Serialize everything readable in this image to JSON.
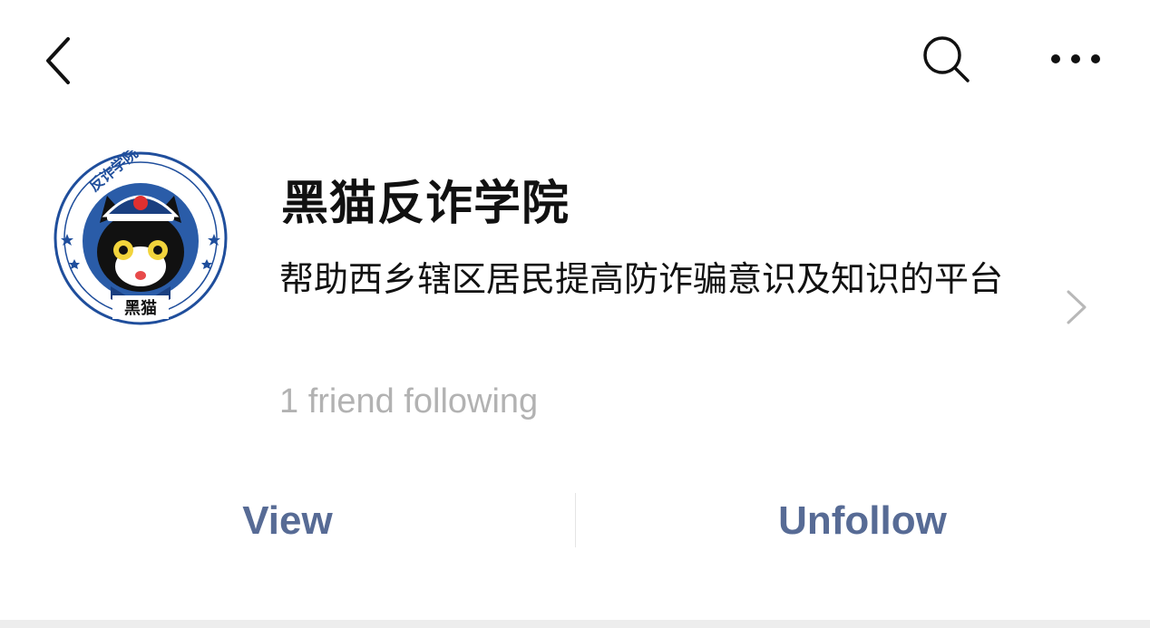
{
  "header": {
    "back_icon": "chevron-left-icon",
    "search_icon": "search-icon",
    "more_icon": "more-horizontal-icon"
  },
  "profile": {
    "name": "黑猫反诈学院",
    "description": "帮助西乡辖区居民提高防诈骗意识及知识的平台",
    "followers": "1 friend following",
    "avatar": {
      "ring_text": "反诈学院",
      "bottom_text": "黑猫",
      "ring_color": "#1f4e9c"
    }
  },
  "actions": {
    "view_label": "View",
    "unfollow_label": "Unfollow",
    "accent_color": "#576b95"
  }
}
